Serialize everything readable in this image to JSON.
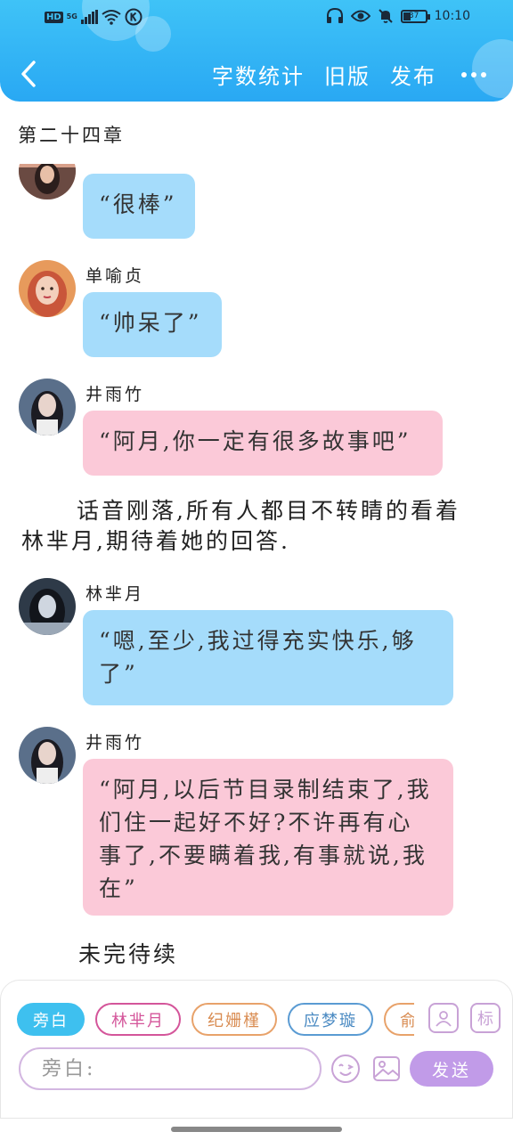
{
  "status_bar": {
    "left_badge": "HD",
    "network": "5G",
    "time": "10:10",
    "battery": "37"
  },
  "header": {
    "actions": [
      "字数统计",
      "旧版",
      "发布"
    ]
  },
  "chapter_title": "第二十四章",
  "messages": [
    {
      "speaker": "",
      "text": "“很棒”",
      "color": "blue"
    },
    {
      "speaker": "单喻贞",
      "text": "“帅呆了”",
      "color": "blue"
    },
    {
      "speaker": "井雨竹",
      "text": "“阿月,你一定有很多故事吧”",
      "color": "pink"
    },
    {
      "speaker": "林芈月",
      "text": "“嗯,至少,我过得充实快乐,够了”",
      "color": "blue"
    },
    {
      "speaker": "井雨竹",
      "text": "“阿月,以后节目录制结束了,我们住一起好不好?不许再有心事了,不要瞒着我,有事就说,我在”",
      "color": "pink"
    }
  ],
  "narration": "话音刚落,所有人都目不转睛的看着林芈月,期待着她的回答.",
  "to_be_continued": "未完待续",
  "input_panel": {
    "chips": [
      "旁白",
      "林芈月",
      "纪姗槿",
      "应梦璇",
      "俞易"
    ],
    "chip_colors": [
      "#3ec0ef",
      "#d4559a",
      "#e8a26a",
      "#5a9bd3",
      "#e8a26a"
    ],
    "side_icons": [
      "person-icon",
      "标"
    ],
    "input_placeholder": "旁白:",
    "send_label": "发送"
  }
}
